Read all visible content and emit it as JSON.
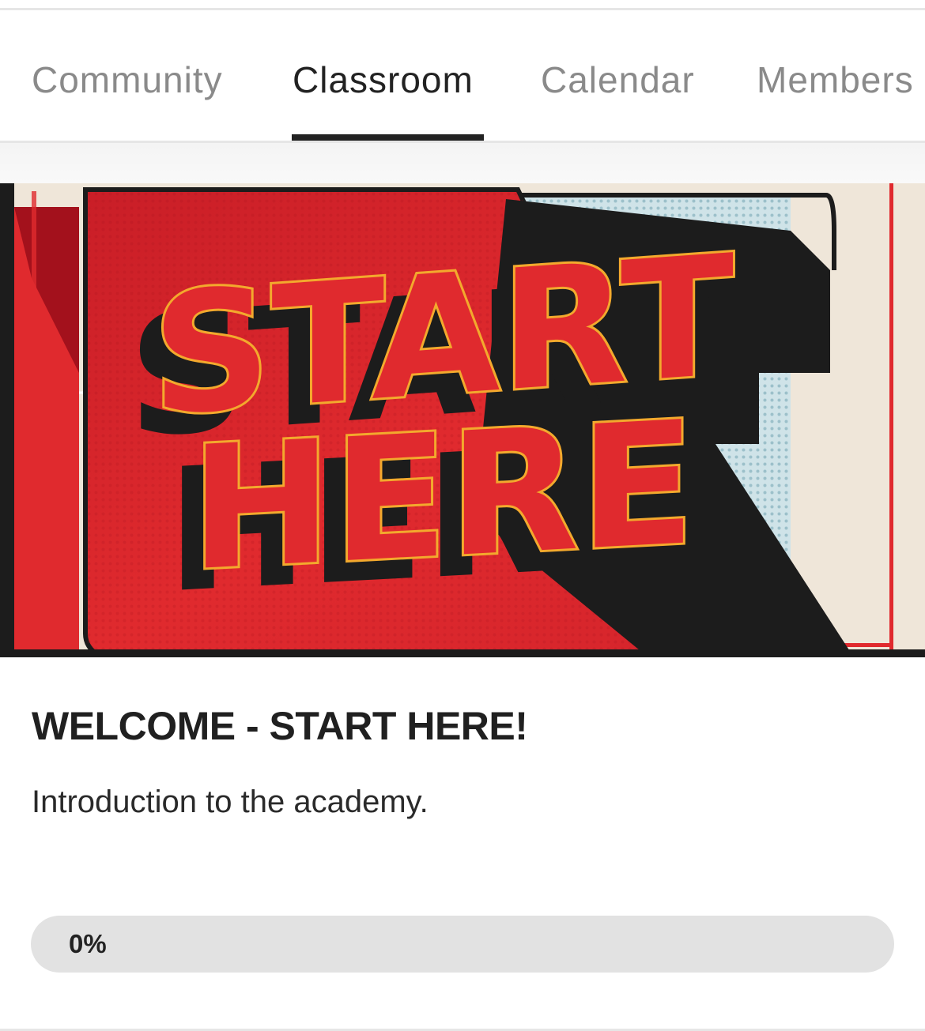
{
  "tabs": [
    {
      "label": "Community",
      "active": false
    },
    {
      "label": "Classroom",
      "active": true
    },
    {
      "label": "Calendar",
      "active": false
    },
    {
      "label": "Members",
      "active": false
    }
  ],
  "banner": {
    "line1": "START",
    "line2": "HERE",
    "colors": {
      "red": "#e02a2e",
      "dark_red": "#a3111c",
      "outline_yellow": "#f3a92d",
      "shadow": "#1c1c1c",
      "cream": "#efe6d9",
      "light_blue": "#cfe3e8"
    }
  },
  "course": {
    "title": "WELCOME - START HERE!",
    "description": "Introduction to the academy.",
    "progress_percent": 0,
    "progress_label": "0%"
  }
}
